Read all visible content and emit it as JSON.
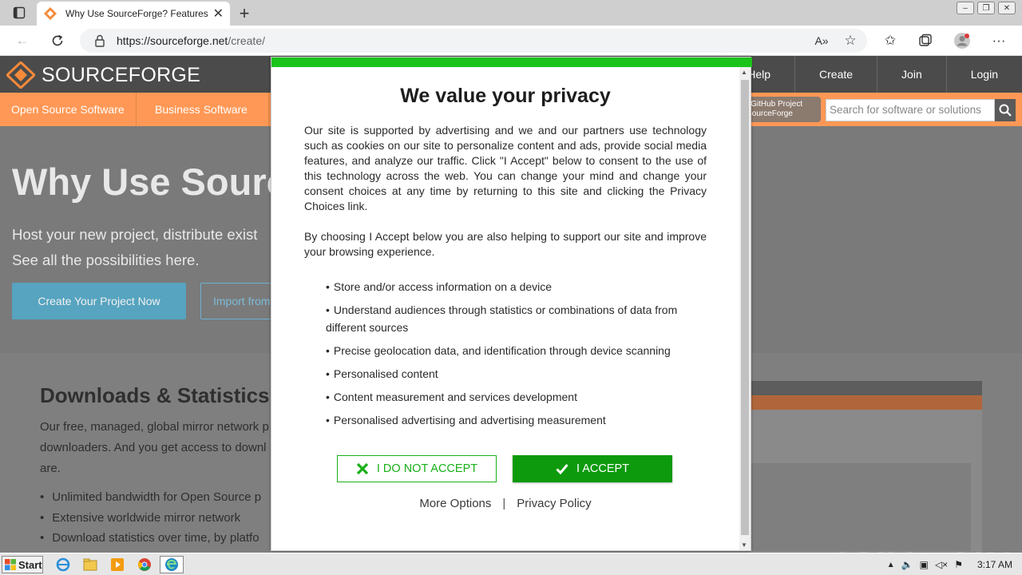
{
  "browser": {
    "tab_title": "Why Use SourceForge? Features a",
    "url_host": "https://sourceforge.net",
    "url_path": "/create/"
  },
  "site": {
    "logo_text": "SOURCEFORGE",
    "topnav": [
      "Help",
      "Create",
      "Join",
      "Login"
    ],
    "subnav": [
      "Open Source Software",
      "Business Software"
    ],
    "github_import": "our GitHub Project\nSourceForge",
    "search_placeholder": "Search for software or solutions"
  },
  "hero": {
    "title": "Why Use Source",
    "subtitle": "Host your new project, distribute exist See all the possibilities here.",
    "primary_button": "Create Your Project Now",
    "secondary_button": "Import from"
  },
  "downloads": {
    "heading": "Downloads & Statistics",
    "description": "Our free, managed, global mirror network p downloaders. And you get access to downl are.",
    "bullets": [
      "Unlimited bandwidth for Open Source p",
      "Extensive worldwide mirror network",
      "Download statistics over time, by platfo"
    ]
  },
  "modal": {
    "title": "We value your privacy",
    "paragraph1": "Our site is supported by advertising and we and our partners use technology such as cookies on our site to personalize content and ads, provide social media features, and analyze our traffic. Click \"I Accept\" below to consent to the use of this technology across the web. You can change your mind and change your consent choices at any time by returning to this site and clicking the Privacy Choices link.",
    "paragraph2": "By choosing I Accept below you are also helping to support our site and improve your browsing experience.",
    "purposes": [
      "Store and/or access information on a device",
      "Understand audiences through statistics or combinations of data from different sources",
      "Precise geolocation data, and identification through device scanning",
      "Personalised content",
      "Content measurement and services development",
      "Personalised advertising and advertising measurement"
    ],
    "decline_label": "I DO NOT ACCEPT",
    "accept_label": "I ACCEPT",
    "more_options": "More Options",
    "separator": "|",
    "privacy_policy": "Privacy Policy"
  },
  "taskbar": {
    "start_label": "Start",
    "clock": "3:17 AM"
  },
  "watermark": "ANY RUN",
  "colors": {
    "accent_green": "#0d9a0d",
    "sf_orange": "#ff9856",
    "sf_dark": "#4b4b4b"
  }
}
